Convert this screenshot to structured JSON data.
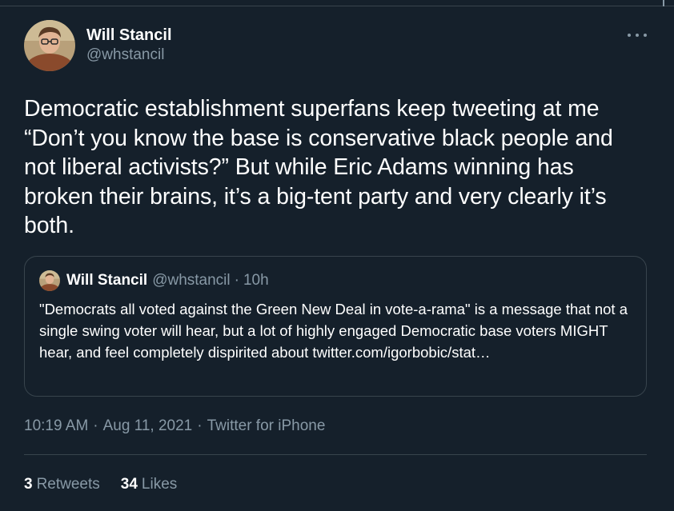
{
  "tweet": {
    "author": {
      "name": "Will Stancil",
      "handle": "@whstancil"
    },
    "text": "Democratic establishment superfans keep tweeting at me “Don’t you know the base is conservative black people and not liberal activists?” But while Eric Adams winning has broken their brains, it’s a big-tent party and very clearly it’s both.",
    "quoted": {
      "name": "Will Stancil",
      "handle": "@whstancil",
      "separator": "·",
      "time": "10h",
      "text": "\"Democrats all voted against the Green New Deal in vote-a-rama\" is a message that not a single swing voter will hear, but a lot of highly engaged Democratic base voters MIGHT hear, and feel completely dispirited about twitter.com/igorbobic/stat…"
    },
    "timestamp": {
      "time": "10:19 AM",
      "sep1": "·",
      "date": "Aug 11, 2021",
      "sep2": "·",
      "source": "Twitter for iPhone"
    },
    "stats": {
      "retweets_count": "3",
      "retweets_label": "Retweets",
      "likes_count": "34",
      "likes_label": "Likes"
    },
    "menu_icon": "more-horizontal-icon"
  },
  "colors": {
    "background": "#15202b",
    "text": "#ffffff",
    "secondary": "#8899a6",
    "border": "#38444d"
  }
}
